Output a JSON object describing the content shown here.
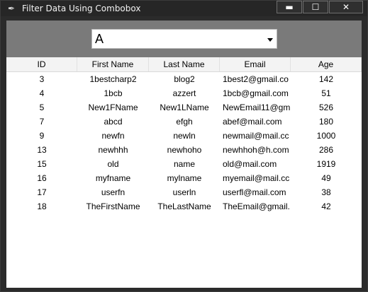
{
  "window": {
    "title": "Filter Data Using Combobox",
    "icon": "feather-icon",
    "controls": {
      "minimize_glyph": "▬",
      "maximize_glyph": "☐",
      "close_glyph": "✕"
    }
  },
  "filter": {
    "combobox_value": "A"
  },
  "table": {
    "headers": [
      "ID",
      "First Name",
      "Last Name",
      "Email",
      "Age"
    ],
    "rows": [
      [
        "3",
        "1bestcharp2",
        "blog2",
        "1best2@gmail.co",
        "142"
      ],
      [
        "4",
        "1bcb",
        "azzert",
        "1bcb@gmail.com",
        "51"
      ],
      [
        "5",
        "New1FName",
        "New1LName",
        "NewEmail11@gm",
        "526"
      ],
      [
        "7",
        "abcd",
        "efgh",
        "abef@mail.com",
        "180"
      ],
      [
        "9",
        "newfn",
        "newln",
        "newmail@mail.cc",
        "1000"
      ],
      [
        "13",
        "newhhh",
        "newhoho",
        "newhhoh@h.com",
        "286"
      ],
      [
        "15",
        "old",
        "name",
        "old@mail.com",
        "1919"
      ],
      [
        "16",
        "myfname",
        "mylname",
        "myemail@mail.cc",
        "49"
      ],
      [
        "17",
        "userfn",
        "userln",
        "userfl@mail.com",
        "38"
      ],
      [
        "18",
        "TheFirstName",
        "TheLastName",
        "TheEmail@gmail.",
        "42"
      ]
    ]
  }
}
